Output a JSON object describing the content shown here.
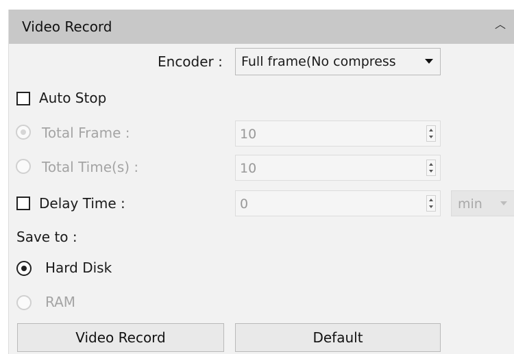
{
  "section": {
    "title": "Video Record",
    "collapse_icon": "chevron-up-icon"
  },
  "encoder": {
    "label": "Encoder :",
    "value": "Full frame(No compress"
  },
  "auto_stop": {
    "label": "Auto Stop",
    "checked": false,
    "total_frame": {
      "label": "Total Frame   :",
      "value": "10",
      "selected": true,
      "enabled": false
    },
    "total_time": {
      "label": "Total Time(s) :",
      "value": "10",
      "selected": false,
      "enabled": false
    }
  },
  "delay_time": {
    "label": "Delay Time :",
    "checked": false,
    "value": "0",
    "unit": "min"
  },
  "save_to": {
    "label": "Save to :",
    "options": [
      {
        "label": "Hard Disk",
        "selected": true,
        "enabled": true
      },
      {
        "label": "RAM",
        "selected": false,
        "enabled": false
      }
    ]
  },
  "buttons": {
    "record": "Video Record",
    "default": "Default"
  }
}
